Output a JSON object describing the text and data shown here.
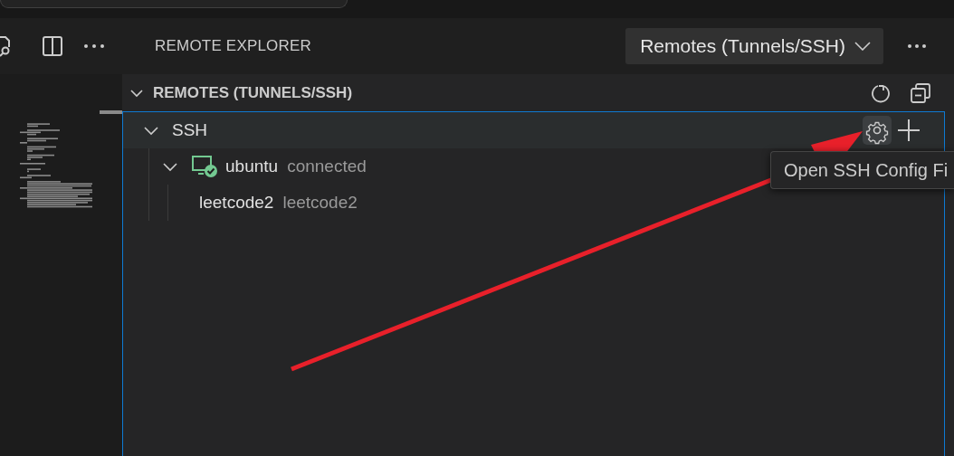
{
  "toolbar": {
    "icons": [
      {
        "kind": "search-file"
      },
      {
        "kind": "split"
      },
      {
        "kind": "more"
      }
    ]
  },
  "panel": {
    "title": "REMOTE EXPLORER",
    "dropdown": {
      "label": "Remotes (Tunnels/SSH)"
    }
  },
  "section": {
    "title": "REMOTES (TUNNELS/SSH)",
    "expanded": true
  },
  "tree": [
    {
      "label": "SSH",
      "expanded": true,
      "hovered": true,
      "children": [
        {
          "label": "ubuntu",
          "detail": "connected",
          "expanded": true,
          "connected": true,
          "children": [
            {
              "label": "leetcode2",
              "detail": "leetcode2"
            }
          ]
        }
      ]
    }
  ],
  "tooltip": {
    "text": "Open SSH Config Fi"
  }
}
